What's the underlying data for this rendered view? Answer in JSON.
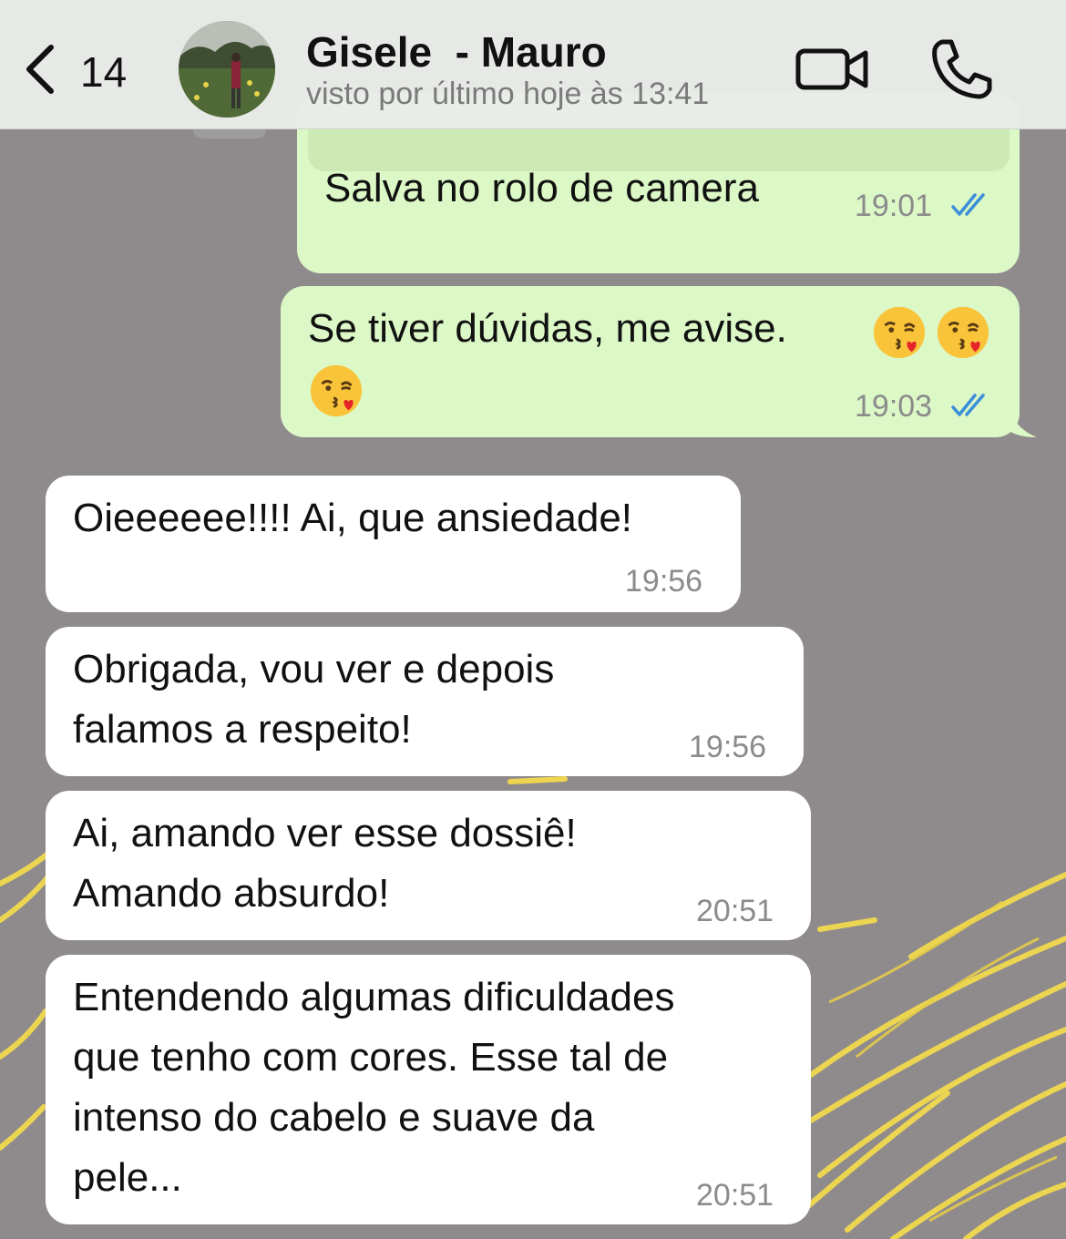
{
  "header": {
    "back_count": "14",
    "contact_name": "Gisele  - Mauro",
    "status": "visto por último hoje às 13:41"
  },
  "messages": [
    {
      "direction": "out",
      "text": "Salva no rolo de camera",
      "time": "19:01",
      "read": true
    },
    {
      "direction": "out",
      "text": "Se tiver dúvidas, me avise.",
      "emoji": "face-blowing-kiss x3",
      "time": "19:03",
      "read": true
    },
    {
      "direction": "in",
      "text": "Oieeeeee!!!! Ai, que ansiedade!",
      "time": "19:56"
    },
    {
      "direction": "in",
      "text": "Obrigada,  vou ver e depois\nfalamos a respeito!",
      "time": "19:56"
    },
    {
      "direction": "in",
      "text": "Ai, amando ver esse dossiê!\nAmando absurdo!",
      "time": "20:51"
    },
    {
      "direction": "in",
      "text": "Entendendo algumas dificuldades\nque tenho com cores. Esse tal de\nintenso do cabelo e suave da\npele...",
      "time": "20:51"
    }
  ],
  "colors": {
    "outgoing_bubble": "#dcf8c6",
    "incoming_bubble": "#ffffff",
    "read_ticks": "#3b8fd8",
    "wallpaper": "#8f8b8d",
    "wallpaper_accent": "#f2d94e"
  }
}
